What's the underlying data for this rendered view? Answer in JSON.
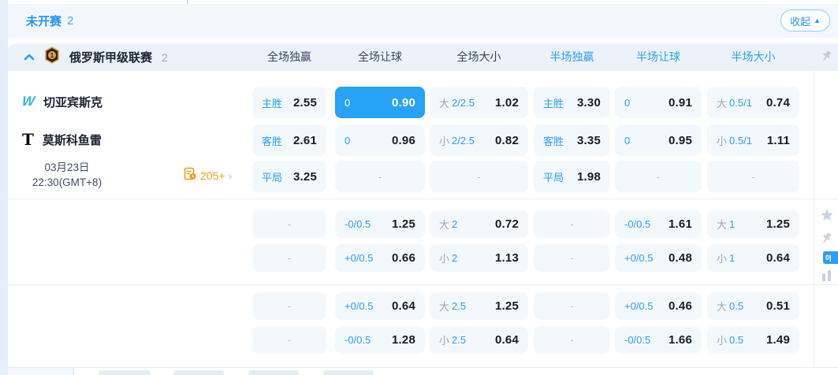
{
  "ui": {
    "dash": "-",
    "collapse_arrow": "▲",
    "chevron_right": "›"
  },
  "topbar": {
    "title": "未开赛",
    "count": "2",
    "collapse_label": "收起"
  },
  "league": {
    "name": "俄罗斯甲级联赛",
    "count": "2"
  },
  "columns": {
    "ft_1x2": "全场独赢",
    "ft_handicap": "全场让球",
    "ft_ou": "全场大小",
    "ht_1x2": "半场独赢",
    "ht_handicap": "半场让球",
    "ht_ou": "半场大小"
  },
  "match": {
    "home": {
      "name": "切亚宾斯克",
      "logo": "W"
    },
    "away": {
      "name": "莫斯科鱼雷",
      "logo": "T"
    },
    "date": "03月23日",
    "time": "22:30(GMT+8)",
    "markets_count": "205+"
  },
  "rail": {
    "badge_text": "0|"
  },
  "odds": {
    "rows": [
      [
        {
          "label": "主胜",
          "value": "2.55"
        },
        {
          "label": "0",
          "value": "0.90",
          "selected": true
        },
        {
          "prefix": "大",
          "label": "2/2.5",
          "value": "1.02"
        },
        {
          "label": "主胜",
          "value": "3.30"
        },
        {
          "label": "0",
          "value": "0.91"
        },
        {
          "prefix": "大",
          "label": "0.5/1",
          "value": "0.74"
        }
      ],
      [
        {
          "label": "客胜",
          "value": "2.61"
        },
        {
          "label": "0",
          "value": "0.96"
        },
        {
          "prefix": "小",
          "label": "2/2.5",
          "value": "0.82"
        },
        {
          "label": "客胜",
          "value": "3.35"
        },
        {
          "label": "0",
          "value": "0.95"
        },
        {
          "prefix": "小",
          "label": "0.5/1",
          "value": "1.11"
        }
      ],
      [
        {
          "label": "平局",
          "value": "3.25"
        },
        {},
        {},
        {
          "label": "平局",
          "value": "1.98"
        },
        {},
        {}
      ],
      [
        {},
        {
          "label": "-0/0.5",
          "value": "1.25"
        },
        {
          "prefix": "大",
          "label": "2",
          "value": "0.72"
        },
        {},
        {
          "label": "-0/0.5",
          "value": "1.61"
        },
        {
          "prefix": "大",
          "label": "1",
          "value": "1.25"
        }
      ],
      [
        {},
        {
          "label": "+0/0.5",
          "value": "0.66"
        },
        {
          "prefix": "小",
          "label": "2",
          "value": "1.13"
        },
        {},
        {
          "label": "+0/0.5",
          "value": "0.48"
        },
        {
          "prefix": "小",
          "label": "1",
          "value": "0.64"
        }
      ],
      [
        {},
        {
          "label": "+0/0.5",
          "value": "0.64"
        },
        {
          "prefix": "大",
          "label": "2.5",
          "value": "1.25"
        },
        {},
        {
          "label": "+0/0.5",
          "value": "0.46"
        },
        {
          "prefix": "大",
          "label": "0.5",
          "value": "0.51"
        }
      ],
      [
        {},
        {
          "label": "-0/0.5",
          "value": "1.28"
        },
        {
          "prefix": "小",
          "label": "2.5",
          "value": "0.64"
        },
        {},
        {
          "label": "-0/0.5",
          "value": "1.66"
        },
        {
          "prefix": "小",
          "label": "0.5",
          "value": "1.49"
        }
      ]
    ]
  }
}
